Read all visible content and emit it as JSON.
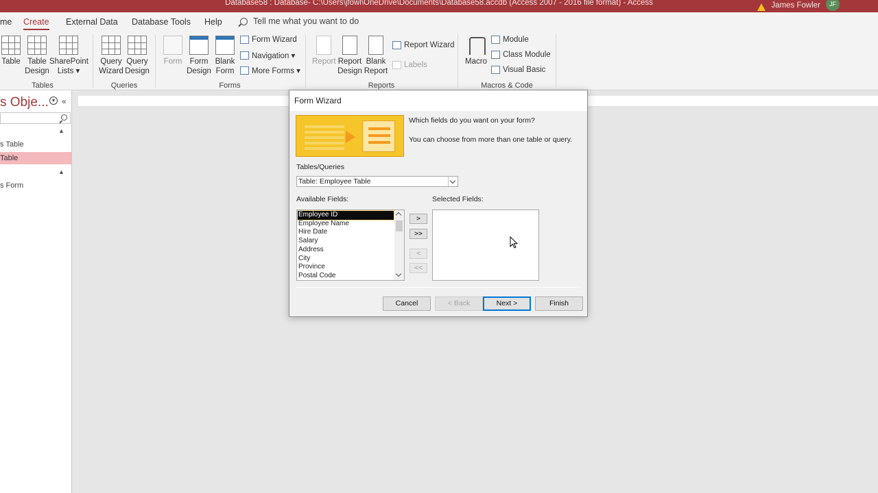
{
  "window": {
    "title": "Database58 : Database- C:\\Users\\jfowl\\OneDrive\\Documents\\Database58.accdb (Access 2007 - 2016 file format)  -  Access",
    "user_name": "James Fowler",
    "user_initials": "JF"
  },
  "ribbon_tabs": [
    {
      "label": "me"
    },
    {
      "label": "Create"
    },
    {
      "label": "External Data"
    },
    {
      "label": "Database Tools"
    },
    {
      "label": "Help"
    }
  ],
  "tell_me": "Tell me what you want to do",
  "ribbon": {
    "tables": {
      "label": "Tables",
      "table": "Table",
      "table_design_1": "Table",
      "table_design_2": "Design",
      "sharepoint_1": "SharePoint",
      "sharepoint_2": "Lists ▾"
    },
    "queries": {
      "label": "Queries",
      "query_wizard_1": "Query",
      "query_wizard_2": "Wizard",
      "query_design_1": "Query",
      "query_design_2": "Design"
    },
    "forms": {
      "label": "Forms",
      "form": "Form",
      "form_design_1": "Form",
      "form_design_2": "Design",
      "blank_form_1": "Blank",
      "blank_form_2": "Form",
      "form_wizard": "Form Wizard",
      "navigation": "Navigation ▾",
      "more_forms": "More Forms ▾"
    },
    "reports": {
      "label": "Reports",
      "report": "Report",
      "report_design_1": "Report",
      "report_design_2": "Design",
      "blank_report_1": "Blank",
      "blank_report_2": "Report",
      "report_wizard": "Report Wizard",
      "labels": "Labels"
    },
    "macros": {
      "label": "Macros & Code",
      "macro": "Macro",
      "module": "Module",
      "class_module": "Class Module",
      "visual_basic": "Visual Basic"
    }
  },
  "nav_pane": {
    "title": "s Obje...",
    "items": [
      {
        "label": "s Table"
      },
      {
        "label": "Table"
      },
      {
        "label": "s Form"
      }
    ]
  },
  "dialog": {
    "title": "Form Wizard",
    "prompt_1": "Which fields do you want on your form?",
    "prompt_2": "You can choose from more than one table or query.",
    "tables_queries_label": "Tables/Queries",
    "tables_queries_value": "Table: Employee Table",
    "available_label": "Available Fields:",
    "selected_label": "Selected Fields:",
    "available_fields": [
      "Employee ID",
      "Employee Name",
      "Hire Date",
      "Salary",
      "Address",
      "City",
      "Province",
      "Postal Code"
    ],
    "move_one": ">",
    "move_all": ">>",
    "remove_one": "<",
    "remove_all": "<<",
    "buttons": {
      "cancel": "Cancel",
      "back": "< Back",
      "next": "Next >",
      "finish": "Finish"
    }
  }
}
